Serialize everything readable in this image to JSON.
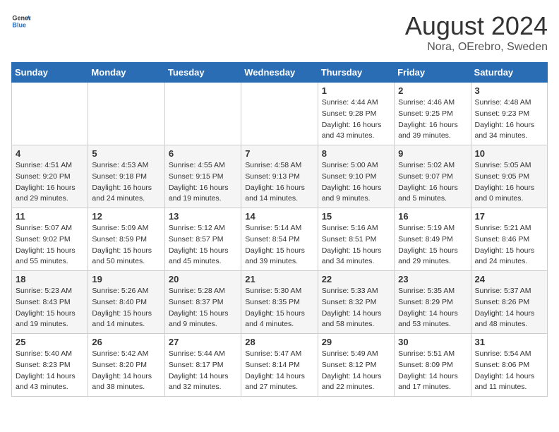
{
  "header": {
    "logo_general": "General",
    "logo_blue": "Blue",
    "month_year": "August 2024",
    "location": "Nora, OErebro, Sweden"
  },
  "weekdays": [
    "Sunday",
    "Monday",
    "Tuesday",
    "Wednesday",
    "Thursday",
    "Friday",
    "Saturday"
  ],
  "weeks": [
    [
      {
        "day": "",
        "info": ""
      },
      {
        "day": "",
        "info": ""
      },
      {
        "day": "",
        "info": ""
      },
      {
        "day": "",
        "info": ""
      },
      {
        "day": "1",
        "info": "Sunrise: 4:44 AM\nSunset: 9:28 PM\nDaylight: 16 hours\nand 43 minutes."
      },
      {
        "day": "2",
        "info": "Sunrise: 4:46 AM\nSunset: 9:25 PM\nDaylight: 16 hours\nand 39 minutes."
      },
      {
        "day": "3",
        "info": "Sunrise: 4:48 AM\nSunset: 9:23 PM\nDaylight: 16 hours\nand 34 minutes."
      }
    ],
    [
      {
        "day": "4",
        "info": "Sunrise: 4:51 AM\nSunset: 9:20 PM\nDaylight: 16 hours\nand 29 minutes."
      },
      {
        "day": "5",
        "info": "Sunrise: 4:53 AM\nSunset: 9:18 PM\nDaylight: 16 hours\nand 24 minutes."
      },
      {
        "day": "6",
        "info": "Sunrise: 4:55 AM\nSunset: 9:15 PM\nDaylight: 16 hours\nand 19 minutes."
      },
      {
        "day": "7",
        "info": "Sunrise: 4:58 AM\nSunset: 9:13 PM\nDaylight: 16 hours\nand 14 minutes."
      },
      {
        "day": "8",
        "info": "Sunrise: 5:00 AM\nSunset: 9:10 PM\nDaylight: 16 hours\nand 9 minutes."
      },
      {
        "day": "9",
        "info": "Sunrise: 5:02 AM\nSunset: 9:07 PM\nDaylight: 16 hours\nand 5 minutes."
      },
      {
        "day": "10",
        "info": "Sunrise: 5:05 AM\nSunset: 9:05 PM\nDaylight: 16 hours\nand 0 minutes."
      }
    ],
    [
      {
        "day": "11",
        "info": "Sunrise: 5:07 AM\nSunset: 9:02 PM\nDaylight: 15 hours\nand 55 minutes."
      },
      {
        "day": "12",
        "info": "Sunrise: 5:09 AM\nSunset: 8:59 PM\nDaylight: 15 hours\nand 50 minutes."
      },
      {
        "day": "13",
        "info": "Sunrise: 5:12 AM\nSunset: 8:57 PM\nDaylight: 15 hours\nand 45 minutes."
      },
      {
        "day": "14",
        "info": "Sunrise: 5:14 AM\nSunset: 8:54 PM\nDaylight: 15 hours\nand 39 minutes."
      },
      {
        "day": "15",
        "info": "Sunrise: 5:16 AM\nSunset: 8:51 PM\nDaylight: 15 hours\nand 34 minutes."
      },
      {
        "day": "16",
        "info": "Sunrise: 5:19 AM\nSunset: 8:49 PM\nDaylight: 15 hours\nand 29 minutes."
      },
      {
        "day": "17",
        "info": "Sunrise: 5:21 AM\nSunset: 8:46 PM\nDaylight: 15 hours\nand 24 minutes."
      }
    ],
    [
      {
        "day": "18",
        "info": "Sunrise: 5:23 AM\nSunset: 8:43 PM\nDaylight: 15 hours\nand 19 minutes."
      },
      {
        "day": "19",
        "info": "Sunrise: 5:26 AM\nSunset: 8:40 PM\nDaylight: 15 hours\nand 14 minutes."
      },
      {
        "day": "20",
        "info": "Sunrise: 5:28 AM\nSunset: 8:37 PM\nDaylight: 15 hours\nand 9 minutes."
      },
      {
        "day": "21",
        "info": "Sunrise: 5:30 AM\nSunset: 8:35 PM\nDaylight: 15 hours\nand 4 minutes."
      },
      {
        "day": "22",
        "info": "Sunrise: 5:33 AM\nSunset: 8:32 PM\nDaylight: 14 hours\nand 58 minutes."
      },
      {
        "day": "23",
        "info": "Sunrise: 5:35 AM\nSunset: 8:29 PM\nDaylight: 14 hours\nand 53 minutes."
      },
      {
        "day": "24",
        "info": "Sunrise: 5:37 AM\nSunset: 8:26 PM\nDaylight: 14 hours\nand 48 minutes."
      }
    ],
    [
      {
        "day": "25",
        "info": "Sunrise: 5:40 AM\nSunset: 8:23 PM\nDaylight: 14 hours\nand 43 minutes."
      },
      {
        "day": "26",
        "info": "Sunrise: 5:42 AM\nSunset: 8:20 PM\nDaylight: 14 hours\nand 38 minutes."
      },
      {
        "day": "27",
        "info": "Sunrise: 5:44 AM\nSunset: 8:17 PM\nDaylight: 14 hours\nand 32 minutes."
      },
      {
        "day": "28",
        "info": "Sunrise: 5:47 AM\nSunset: 8:14 PM\nDaylight: 14 hours\nand 27 minutes."
      },
      {
        "day": "29",
        "info": "Sunrise: 5:49 AM\nSunset: 8:12 PM\nDaylight: 14 hours\nand 22 minutes."
      },
      {
        "day": "30",
        "info": "Sunrise: 5:51 AM\nSunset: 8:09 PM\nDaylight: 14 hours\nand 17 minutes."
      },
      {
        "day": "31",
        "info": "Sunrise: 5:54 AM\nSunset: 8:06 PM\nDaylight: 14 hours\nand 11 minutes."
      }
    ]
  ]
}
